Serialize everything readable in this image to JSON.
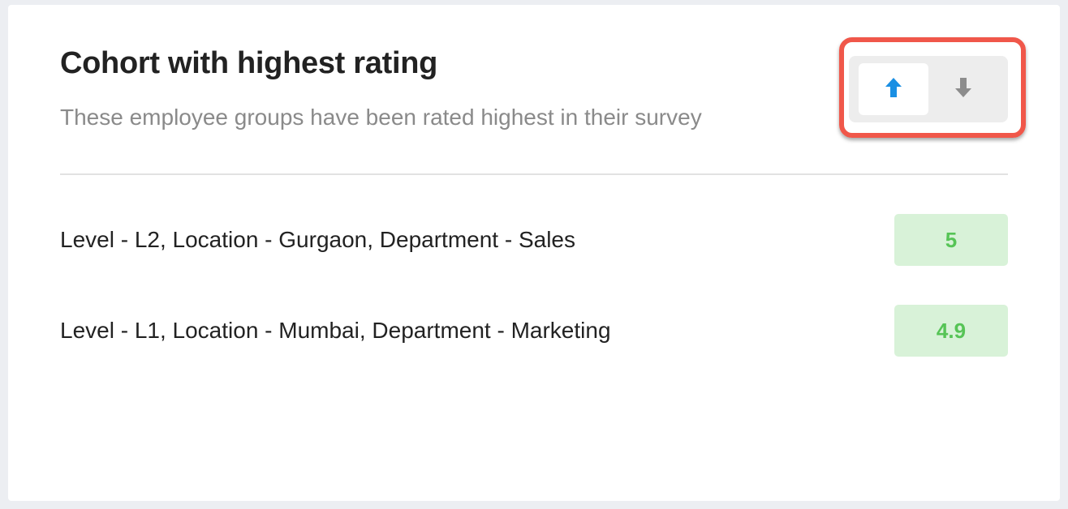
{
  "card": {
    "title": "Cohort with highest rating",
    "subtitle": "These employee groups have been rated highest in their survey"
  },
  "sort_toggle": {
    "selected": "ascending",
    "options": [
      {
        "id": "ascending",
        "icon": "arrow-up-icon",
        "color": "#1a8fe3"
      },
      {
        "id": "descending",
        "icon": "arrow-down-icon",
        "color": "#8c8c8c"
      }
    ],
    "highlight_color": "#f0574a"
  },
  "cohorts": [
    {
      "label": "Level - L2, Location - Gurgaon, Department - Sales",
      "score": "5"
    },
    {
      "label": "Level - L1, Location - Mumbai, Department - Marketing",
      "score": "4.9"
    }
  ],
  "colors": {
    "score_bg": "#d8f2d8",
    "score_text": "#56c456"
  }
}
